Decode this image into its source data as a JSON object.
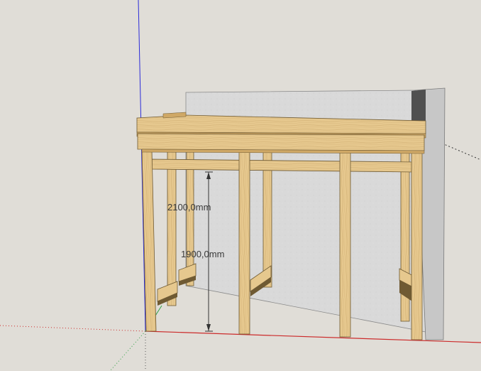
{
  "viewport": {
    "background": "#e0ddd7",
    "colors": {
      "wall": "#d9d9d9",
      "wall_side": "#c7c7c7",
      "wall_top": "#505050",
      "wood": "#e6c88e",
      "wood_dark": "#cfa866",
      "wood_shadow": "#6f5a33",
      "axis_red": "#cc2b2b",
      "axis_green": "#2ea043",
      "axis_blue": "#2b2bd9"
    }
  },
  "dimensions": {
    "dim1": "2100,0mm",
    "dim2": "1900,0mm"
  }
}
